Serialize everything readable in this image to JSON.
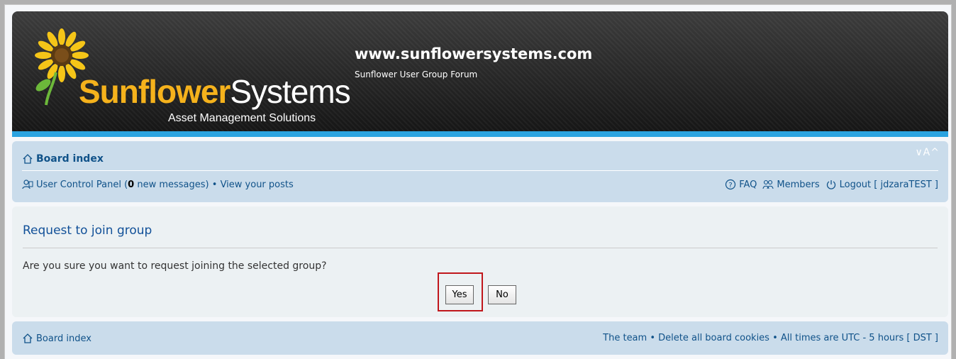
{
  "header": {
    "logo_bold": "Sunflower",
    "logo_light": "Systems",
    "logo_tagline": "Asset Management Solutions",
    "site_title": "www.sunflowersystems.com",
    "site_description": "Sunflower User Group Forum"
  },
  "nav": {
    "board_index": "Board index",
    "font_size_toggle": "∨A^",
    "ucp_label": "User Control Panel (",
    "new_count": "0",
    "new_messages_suffix": " new messages)",
    "separator": " • ",
    "view_posts": "View your posts",
    "faq": "FAQ",
    "members": "Members",
    "logout": "Logout [ jdzaraTEST ]"
  },
  "panel": {
    "title": "Request to join group",
    "message": "Are you sure you want to request joining the selected group?",
    "yes_label": "Yes",
    "no_label": "No"
  },
  "footer": {
    "board_index": "Board index",
    "team": "The team",
    "separator": " • ",
    "delete_cookies": "Delete all board cookies",
    "timezone": "All times are UTC - 5 hours [ DST ]"
  },
  "colors": {
    "header_accent": "#2aa3e0",
    "link": "#105289",
    "logo_gold": "#f5b21c",
    "highlight": "#c0171c"
  }
}
